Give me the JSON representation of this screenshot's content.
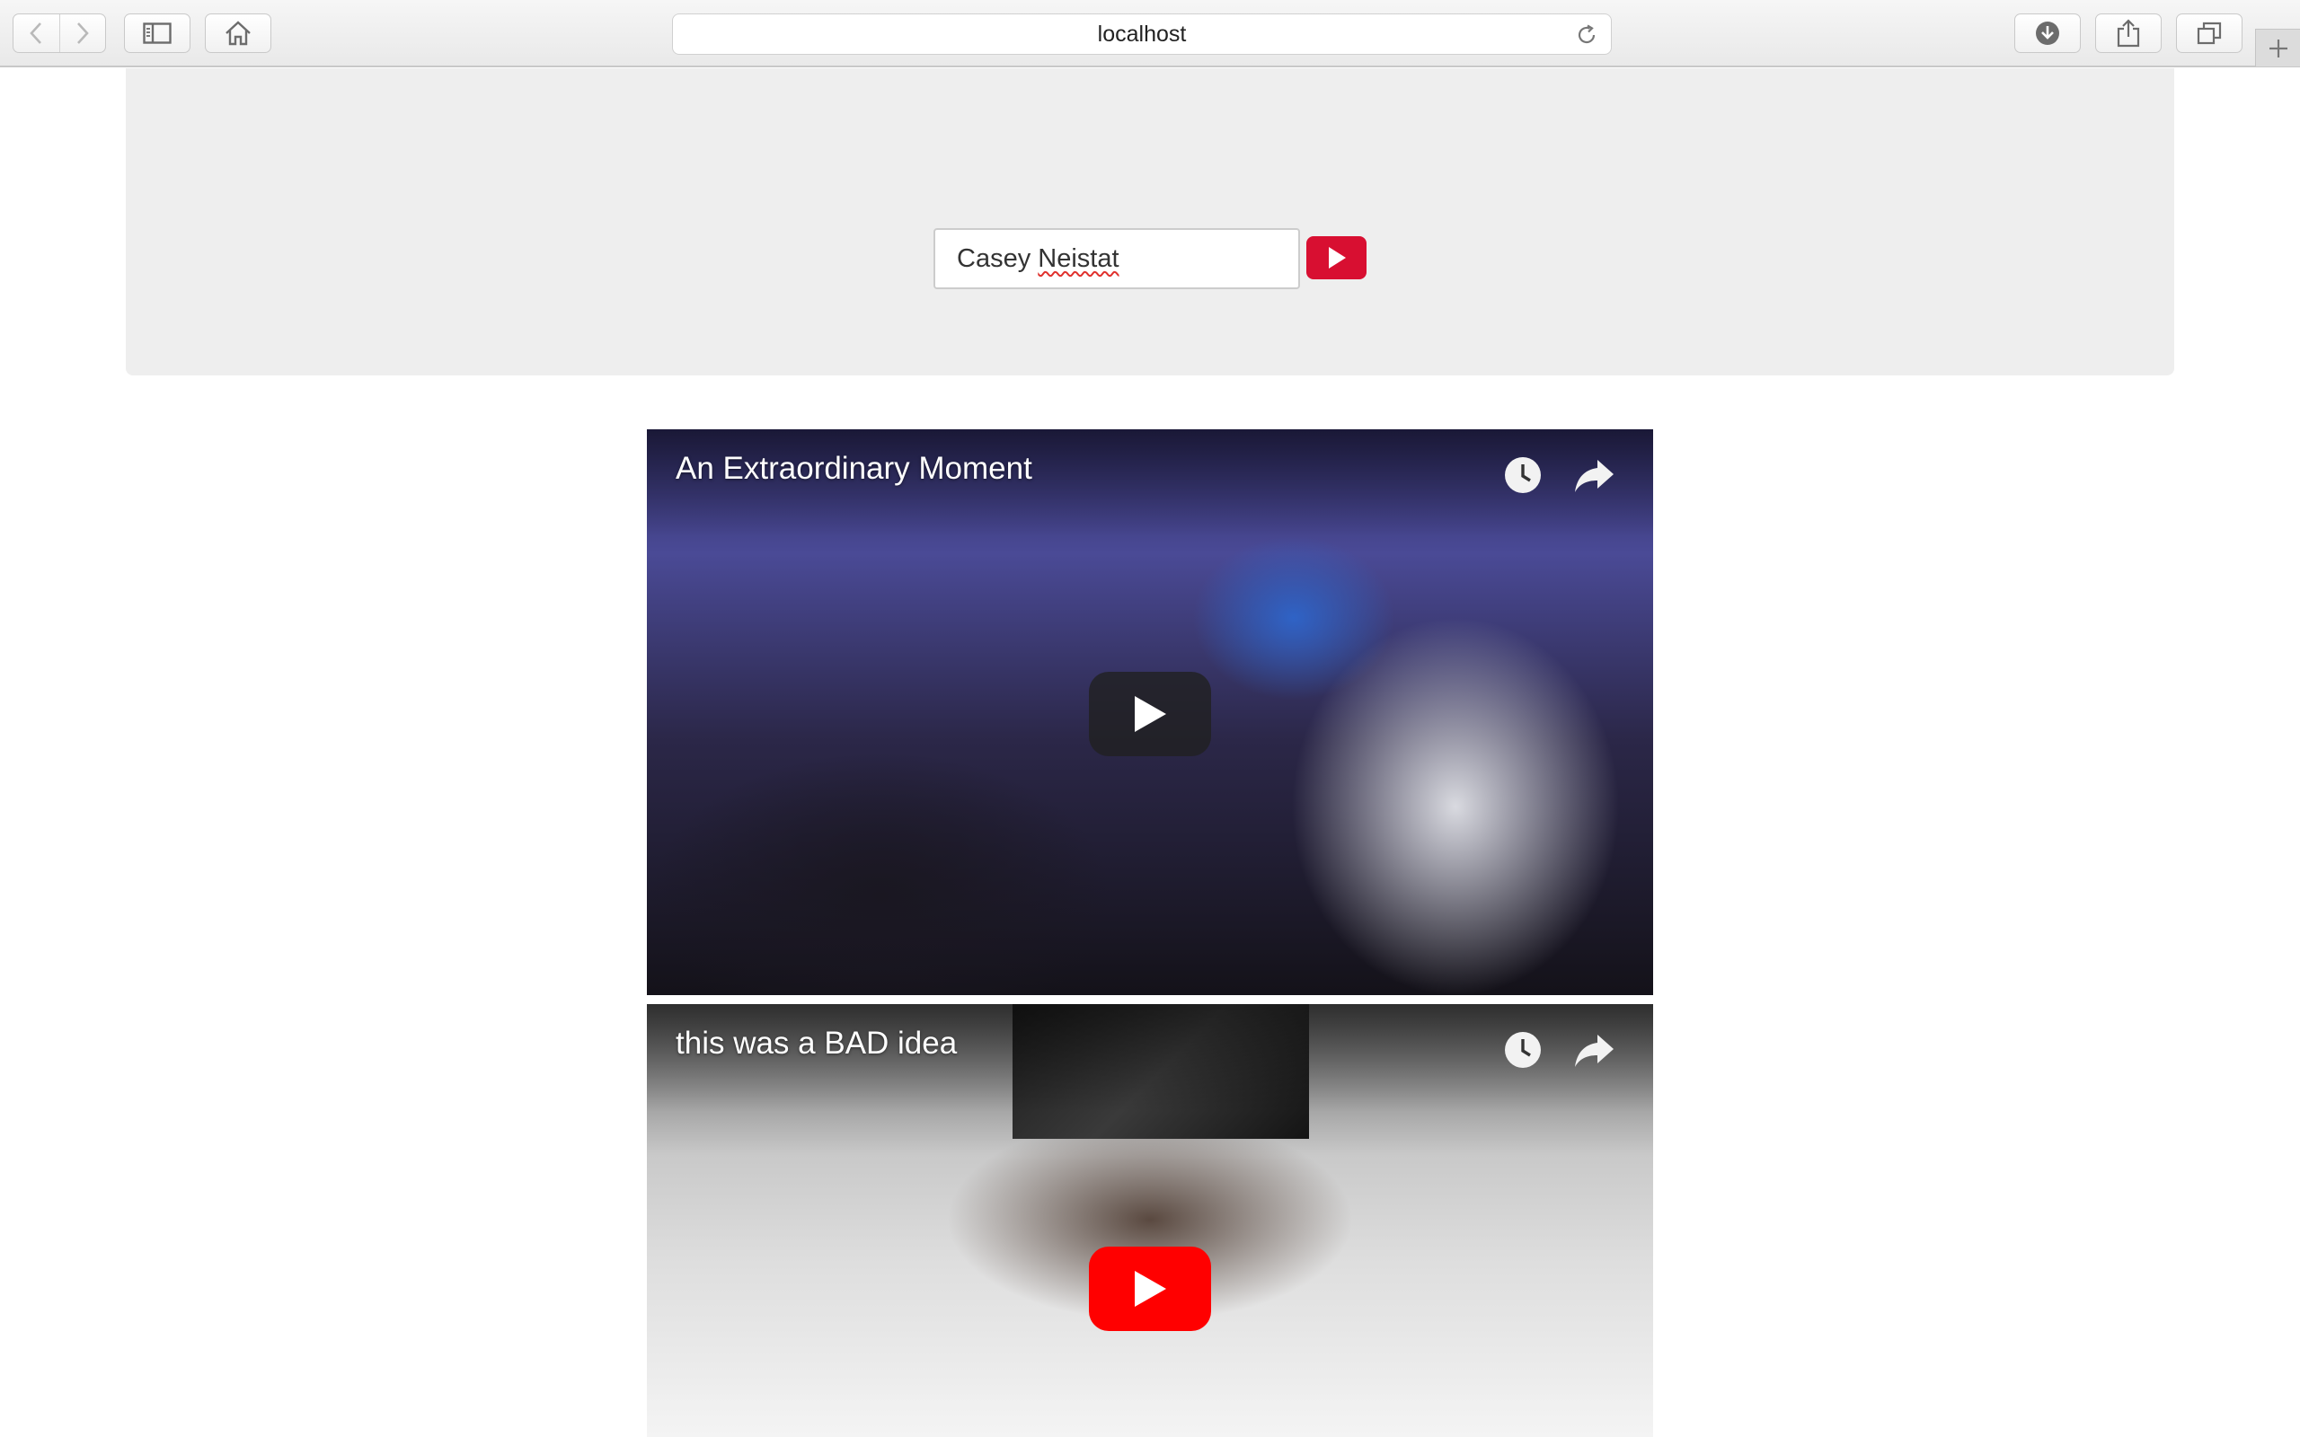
{
  "browser": {
    "address": "localhost",
    "icons": [
      "back-icon",
      "forward-icon",
      "sidebar-icon",
      "home-icon",
      "reload-icon",
      "download-icon",
      "share-icon",
      "tabs-icon",
      "plus-icon"
    ]
  },
  "search": {
    "value_word1": "Casey",
    "value_word2": "Neistat",
    "button_icon": "play-icon",
    "button_color": "#d80f31"
  },
  "videos": [
    {
      "title": "An Extraordinary Moment",
      "play_style": "dark"
    },
    {
      "title": "this was a BAD idea",
      "play_style": "red"
    }
  ],
  "colors": {
    "jumbotron_bg": "#eeeeee",
    "youtube_red": "#ff0000"
  }
}
